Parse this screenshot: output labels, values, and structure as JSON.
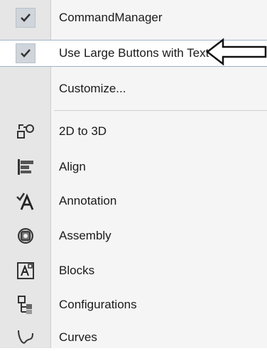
{
  "menu": {
    "items": [
      {
        "label": "CommandManager",
        "checked": true,
        "icon": "checkmark-icon"
      },
      {
        "label": "Use Large Buttons with Text",
        "checked": true,
        "icon": "checkmark-icon",
        "highlighted": true
      },
      {
        "label": "Customize...",
        "checked": false
      }
    ],
    "toolbars": [
      {
        "label": "2D to 3D",
        "icon": "2d-to-3d-icon"
      },
      {
        "label": "Align",
        "icon": "align-icon"
      },
      {
        "label": "Annotation",
        "icon": "annotation-icon"
      },
      {
        "label": "Assembly",
        "icon": "assembly-icon"
      },
      {
        "label": "Blocks",
        "icon": "blocks-icon"
      },
      {
        "label": "Configurations",
        "icon": "configurations-icon"
      },
      {
        "label": "Curves",
        "icon": "curves-icon"
      }
    ]
  },
  "annotation_arrow": {
    "icon": "left-arrow-icon",
    "direction": "left"
  },
  "colors": {
    "gutter": "#e6e6e6",
    "menu_bg": "#f5f5f5",
    "highlight_border": "#9fb3c7",
    "check_bg": "#cfd5db"
  }
}
